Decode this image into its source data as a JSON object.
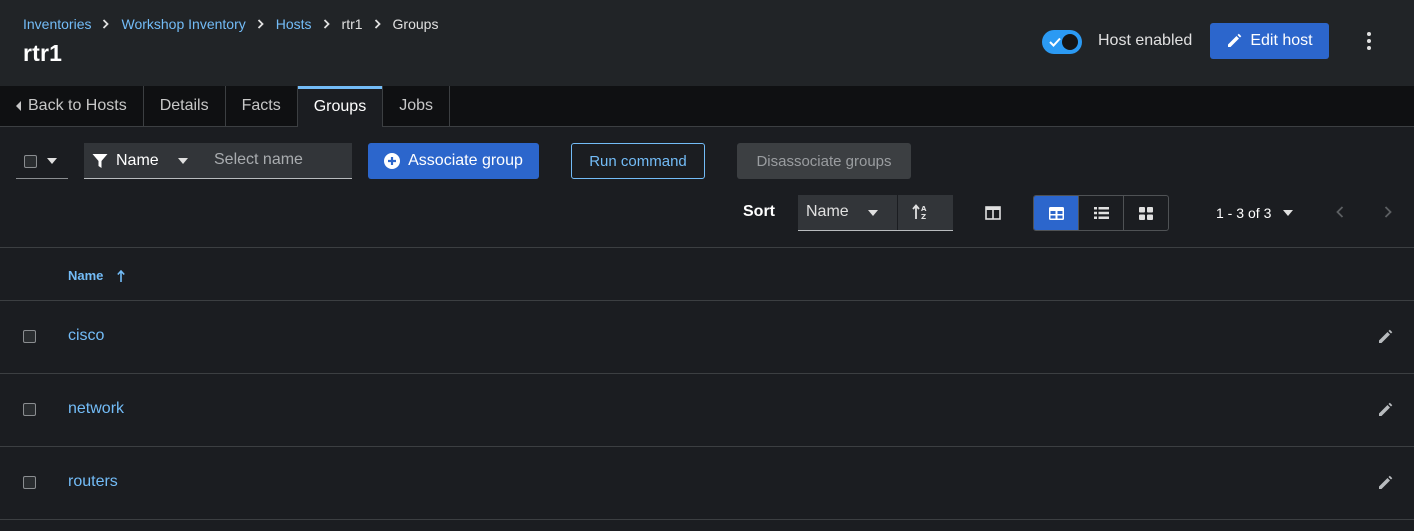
{
  "breadcrumb": {
    "items": [
      "Inventories",
      "Workshop Inventory",
      "Hosts",
      "rtr1",
      "Groups"
    ]
  },
  "header": {
    "title": "rtr1",
    "toggle_label": "Host enabled",
    "toggle_on": true,
    "edit_button": "Edit host"
  },
  "tabs": {
    "back": "Back to Hosts",
    "details": "Details",
    "facts": "Facts",
    "groups": "Groups",
    "jobs": "Jobs",
    "active": "Groups"
  },
  "toolbar": {
    "filter_attribute": "Name",
    "filter_placeholder": "Select name",
    "associate_button": "Associate group",
    "run_command_button": "Run command",
    "disassociate_button": "Disassociate groups",
    "sort_label": "Sort",
    "sort_field": "Name",
    "view_active": "table"
  },
  "pagination": {
    "range": "1 - 3",
    "total": "of 3"
  },
  "table": {
    "column_name": "Name",
    "rows": [
      {
        "name": "cisco"
      },
      {
        "name": "network"
      },
      {
        "name": "routers"
      }
    ]
  },
  "colors": {
    "link": "#73bcf7",
    "primary": "#2c66cc",
    "toggle_on": "#2b9af3",
    "background": "#1b1d21",
    "header_bg": "#212427"
  }
}
